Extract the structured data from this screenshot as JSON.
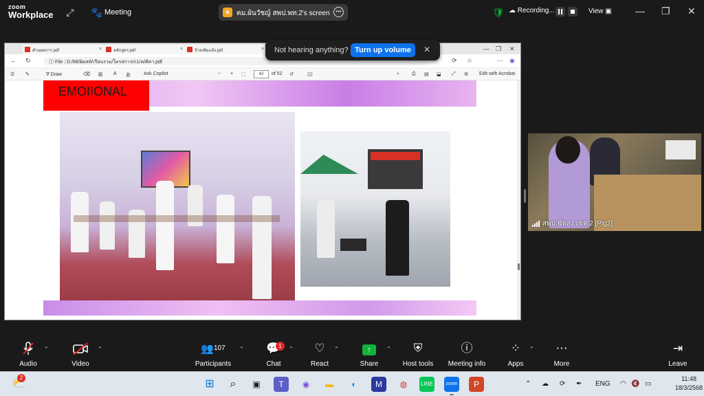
{
  "app": {
    "brand_top": "zoom",
    "brand_bottom": "Workplace",
    "meeting_label": "Meeting",
    "share_initial": "ค",
    "share_title": "คม.ผ้นวัชญ์ สพป.พท.2's screen",
    "recording_label": "Recording...",
    "view_label": "View"
  },
  "browser": {
    "tabs": [
      {
        "label": "คำนผลการ.pdf"
      },
      {
        "label": "หลักสูตร.pdf"
      },
      {
        "label": "ป้ายเพิ่มแล้ง.pdf"
      }
    ],
    "url_prefix": "File",
    "url": "D:/68/ผิดสท์/เรียนรวม/ใครสการ/ก1/ค/ศิคา.pdf",
    "pdf_toolbar": {
      "draw": "Draw",
      "ask_copilot": "Ask Copilot",
      "page_current": "42",
      "page_total": "of 52",
      "edit_acrobat": "Edit with Acrobat"
    },
    "slide_heading": "EMOIIONAL"
  },
  "notice": {
    "message": "Not hearing anything?",
    "button": "Turn up volume"
  },
  "video_tile": {
    "name": "สพป.พัทลุง เขต 2 [Plg2]"
  },
  "toolbar": {
    "audio": "Audio",
    "video": "Video",
    "participants_count": "107",
    "participants": "Participants",
    "chat": "Chat",
    "chat_badge": "1",
    "react": "React",
    "share": "Share",
    "host_tools": "Host tools",
    "meeting_info": "Meeting info",
    "apps": "Apps",
    "more": "More",
    "leave": "Leave"
  },
  "taskbar": {
    "weather_badge": "2",
    "language": "ENG",
    "time": "11:48",
    "date": "18/3/2568"
  },
  "colors": {
    "zoom_blue": "#0e72ed",
    "share_green": "#12b43a",
    "leave_red": "#e02828",
    "slide_red": "#ff0000"
  }
}
